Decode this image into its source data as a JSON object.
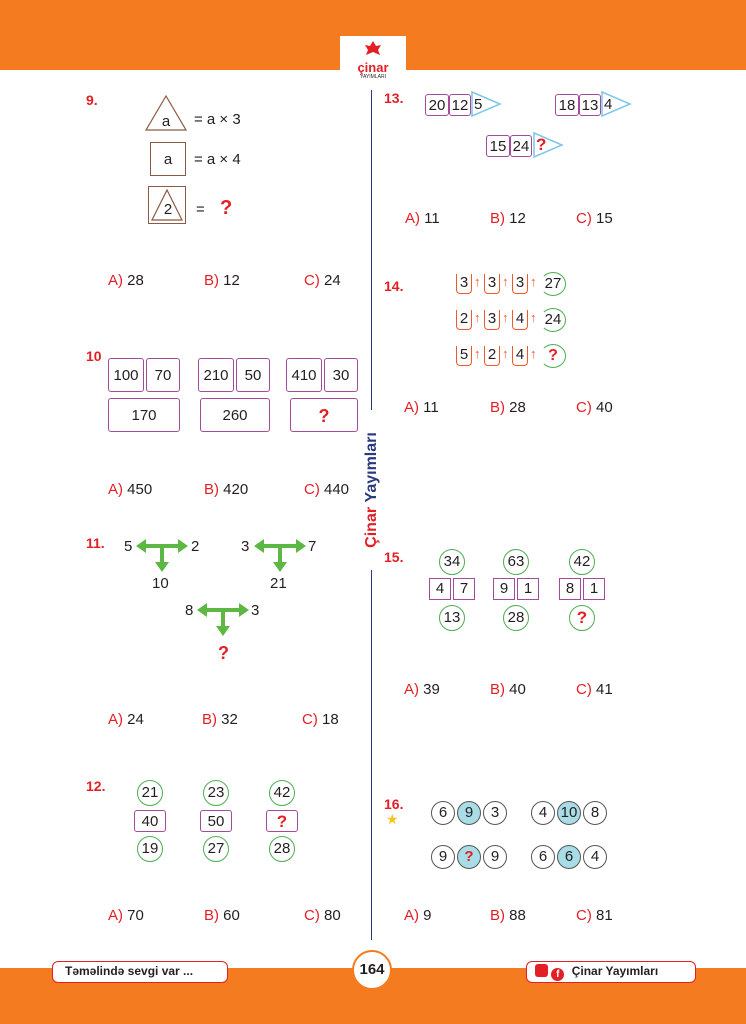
{
  "header": {
    "logo_text": "çinar",
    "logo_sub": "YAYIMLARI"
  },
  "side_label": {
    "brand": "Çinar",
    "rest": "Yayımları"
  },
  "q9": {
    "number": "9.",
    "tri": "a",
    "tri_rule": "= a × 3",
    "sq": "a",
    "sq_rule": "= a × 4",
    "combo": "2",
    "combo_eq": "=",
    "combo_q": "?",
    "a": "A)",
    "av": "28",
    "b": "B)",
    "bv": "12",
    "c": "C)",
    "cv": "24"
  },
  "q10": {
    "number": "10",
    "p1a": "100",
    "p1b": "70",
    "p1s": "170",
    "p2a": "210",
    "p2b": "50",
    "p2s": "260",
    "p3a": "410",
    "p3b": "30",
    "p3s": "?",
    "a": "A)",
    "av": "450",
    "b": "B)",
    "bv": "420",
    "c": "C)",
    "cv": "440"
  },
  "q11": {
    "number": "11.",
    "g1l": "5",
    "g1r": "2",
    "g1d": "10",
    "g2l": "3",
    "g2r": "7",
    "g2d": "21",
    "g3l": "8",
    "g3r": "3",
    "g3d": "?",
    "a": "A)",
    "av": "24",
    "b": "B)",
    "bv": "32",
    "c": "C)",
    "cv": "18"
  },
  "q12": {
    "number": "12.",
    "c1t": "21",
    "c1m": "40",
    "c1b": "19",
    "c2t": "23",
    "c2m": "50",
    "c2b": "27",
    "c3t": "42",
    "c3m": "?",
    "c3b": "28",
    "a": "A)",
    "av": "70",
    "b": "B)",
    "bv": "60",
    "c": "C)",
    "cv": "80"
  },
  "q13": {
    "number": "13.",
    "r1a": "20",
    "r1b": "12",
    "r1c": "5",
    "r2a": "18",
    "r2b": "13",
    "r2c": "4",
    "r3a": "15",
    "r3b": "24",
    "r3c": "?",
    "a": "A)",
    "av": "11",
    "b": "B)",
    "bv": "12",
    "c": "C)",
    "cv": "15"
  },
  "q14": {
    "number": "14.",
    "r1": [
      "3",
      "3",
      "3",
      "27"
    ],
    "r2": [
      "2",
      "3",
      "4",
      "24"
    ],
    "r3": [
      "5",
      "2",
      "4",
      "?"
    ],
    "a": "A)",
    "av": "11",
    "b": "B)",
    "bv": "28",
    "c": "C)",
    "cv": "40"
  },
  "q15": {
    "number": "15.",
    "g1t": "34",
    "g1l": "4",
    "g1r": "7",
    "g1b": "13",
    "g2t": "63",
    "g2l": "9",
    "g2r": "1",
    "g2b": "28",
    "g3t": "42",
    "g3l": "8",
    "g3r": "1",
    "g3b": "?",
    "a": "A)",
    "av": "39",
    "b": "B)",
    "bv": "40",
    "c": "C)",
    "cv": "41"
  },
  "q16": {
    "number": "16.",
    "r1a": [
      "6",
      "9",
      "3"
    ],
    "r1b": [
      "4",
      "10",
      "8"
    ],
    "r2a": [
      "9",
      "?",
      "9"
    ],
    "r2b": [
      "6",
      "6",
      "4"
    ],
    "a": "A)",
    "av": "9",
    "b": "B)",
    "bv": "88",
    "c": "C)",
    "cv": "81"
  },
  "footer": {
    "motto": "Təməlində sevgi var ...",
    "page": "164",
    "publisher": "Çinar Yayımları"
  },
  "colors": {
    "orange": "#f47b20",
    "red": "#e31e24",
    "purple": "#a34a98",
    "green": "#4caf50",
    "navy": "#2a3a7c"
  }
}
